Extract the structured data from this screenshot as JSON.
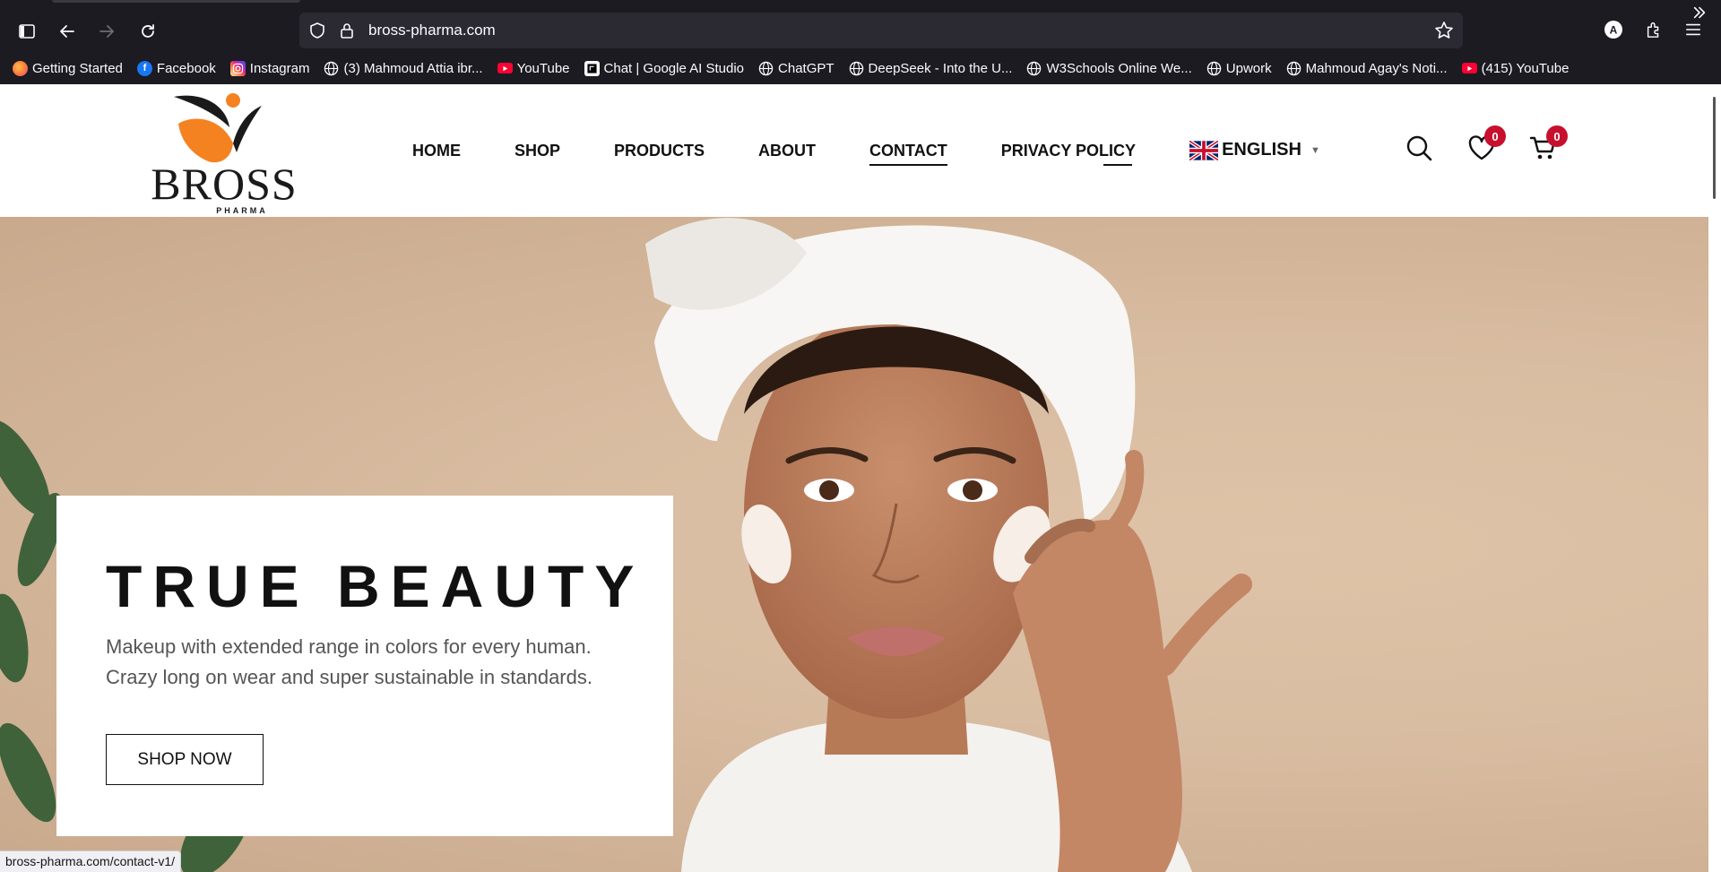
{
  "browser": {
    "url": "bross-pharma.com",
    "status_url": "bross-pharma.com/contact-v1/",
    "profile_initial": "A",
    "bookmarks": [
      {
        "label": "Getting Started",
        "icon": "firefox-icon",
        "color": "#ff7139"
      },
      {
        "label": "Facebook",
        "icon": "facebook-icon",
        "color": "#1877f2"
      },
      {
        "label": "Instagram",
        "icon": "instagram-icon",
        "color": "#d6249f"
      },
      {
        "label": "(3) Mahmoud Attia ibr...",
        "icon": "globe-icon",
        "color": ""
      },
      {
        "label": "YouTube",
        "icon": "youtube-icon",
        "color": "#ff0033"
      },
      {
        "label": "Chat | Google AI Studio",
        "icon": "ai-studio-icon",
        "color": "#000000"
      },
      {
        "label": "ChatGPT",
        "icon": "globe-icon",
        "color": ""
      },
      {
        "label": "DeepSeek - Into the U...",
        "icon": "globe-icon",
        "color": ""
      },
      {
        "label": "W3Schools Online We...",
        "icon": "globe-icon",
        "color": ""
      },
      {
        "label": "Upwork",
        "icon": "globe-icon",
        "color": ""
      },
      {
        "label": "Mahmoud Agay's Noti...",
        "icon": "globe-icon",
        "color": ""
      },
      {
        "label": "(415) YouTube",
        "icon": "youtube-icon",
        "color": "#ff0033"
      }
    ]
  },
  "site": {
    "logo": {
      "name": "BROSS",
      "sub": "PHARMA",
      "accent": "#f58220"
    },
    "nav": [
      "HOME",
      "SHOP",
      "PRODUCTS",
      "ABOUT",
      "CONTACT",
      "PRIVACY POLICY"
    ],
    "active_nav": "CONTACT",
    "language": "ENGLISH",
    "wishlist_count": "0",
    "cart_count": "0",
    "badge_color": "#c8102e"
  },
  "hero": {
    "title": "TRUE BEAUTY",
    "description_line1": "Makeup with extended range in colors for every human.",
    "description_line2": "Crazy long on wear and super sustainable in standards.",
    "button": "SHOP NOW",
    "background_color": "#d9bda2"
  }
}
